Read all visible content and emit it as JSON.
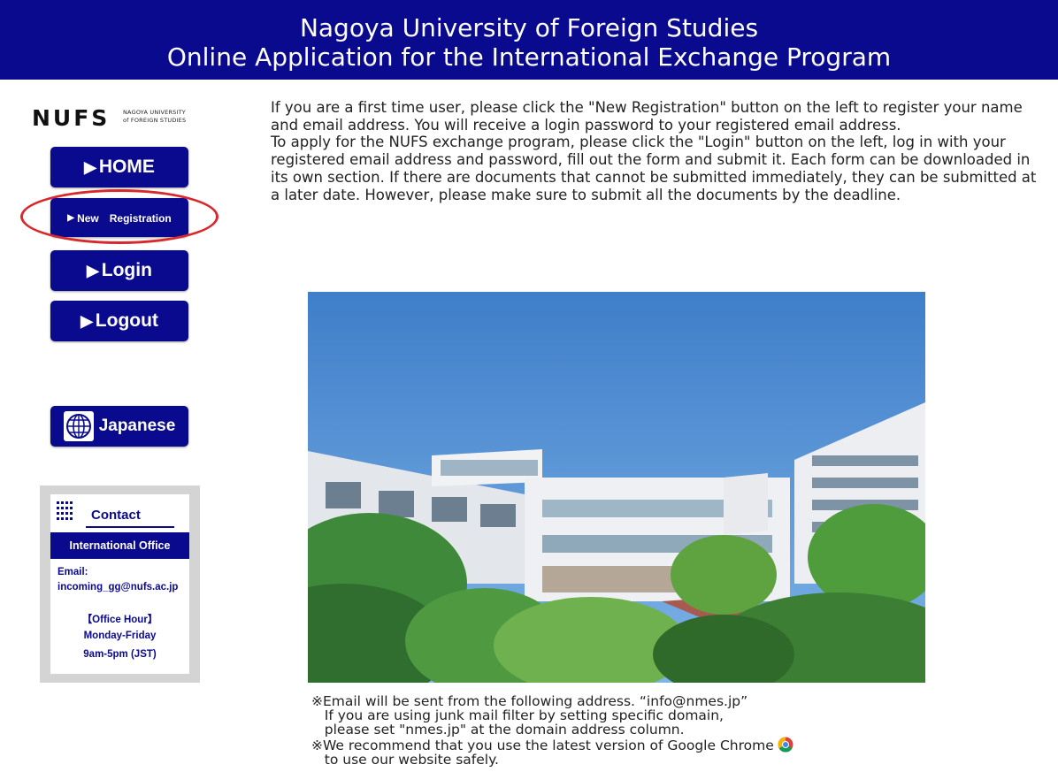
{
  "header": {
    "title_line1": "Nagoya University of Foreign Studies",
    "title_line2": "Online Application for the International Exchange Program"
  },
  "logo": {
    "mark": "NUFS",
    "sub_line1": "NAGOYA UNIVERSITY",
    "sub_line2": "of FOREIGN STUDIES"
  },
  "nav": {
    "home": "HOME",
    "new_registration": "New　Registration",
    "login": "Login",
    "logout": "Logout",
    "japanese": "Japanese",
    "triangle_glyph": "▶"
  },
  "contact": {
    "title": "Contact",
    "office": "International Office",
    "email_label": "Email:",
    "email": "incoming_gg@nufs.ac.jp",
    "office_hour_label": "【Office Hour】",
    "days": "Monday-Friday",
    "hours": "9am-5pm (JST)"
  },
  "intro": {
    "p1": "If you are a first time user, please click the \"New Registration\" button on the left to register your name and email address. You will receive a login password to your registered email address.",
    "p2": "To apply for the NUFS exchange program, please click the \"Login\" button on the left, log in with your registered email address and password, fill out the form and submit it. Each form can be downloaded in its own section. If there are documents that cannot be submitted immediately, they can be submitted at a later date. However, please make sure to submit all the documents by the deadline."
  },
  "notes": {
    "line1": "※Email will be sent from the following address. “info@nmes.jp”",
    "line2": "   If you are using junk mail filter by setting specific domain,",
    "line3": "   please set \"nmes.jp\" at the domain address column.",
    "line4": "※We recommend that you use the latest version of Google Chrome",
    "line5": "   to use our website safely."
  },
  "colors": {
    "brand_blue": "#0a0a8f",
    "highlight_red": "#d7292c",
    "contact_panel": "#d4d4d4"
  },
  "icons": {
    "globe": "globe-icon",
    "contact_grid": "grid-dots-icon",
    "chrome": "chrome-icon"
  }
}
